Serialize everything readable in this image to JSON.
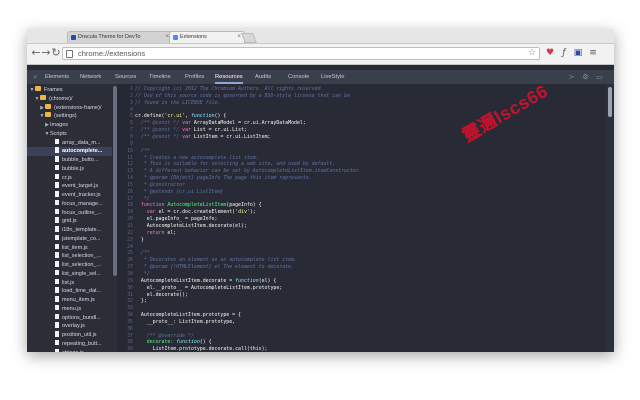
{
  "browser": {
    "tabs": [
      {
        "title": "Dracula Theme for DevTo",
        "close": "×",
        "favicon_color": "#1f4fb5",
        "active": false
      },
      {
        "title": "Extensions",
        "close": "×",
        "favicon_color": "#4c8bf5",
        "active": true
      }
    ],
    "nav": {
      "back": "←",
      "forward": "→",
      "reload": "↻"
    },
    "address": {
      "url": "chrome://extensions",
      "star": "☆"
    },
    "extension_icons": [
      "pocket-icon",
      "font-icon",
      "page-icon",
      "menu-icon"
    ],
    "extension_glyphs": [
      "♥",
      "ƒ",
      "▣",
      "≡"
    ]
  },
  "devtools": {
    "tabs": [
      "Elements",
      "Network",
      "Sources",
      "Timeline",
      "Profiles",
      "Resources",
      "Audits",
      "Console",
      "LiveStyle"
    ],
    "active_tab": "Resources",
    "search_glyph": "⌕",
    "right_glyphs": [
      "≻",
      "⚙",
      "▭"
    ]
  },
  "sidebar": {
    "rows": [
      {
        "label": "Frames",
        "depth": 0,
        "kind": "folder",
        "expanded": true,
        "selected": false
      },
      {
        "label": "(chrome)/",
        "depth": 1,
        "kind": "folder",
        "expanded": true,
        "selected": false
      },
      {
        "label": "(extensions-frame)/",
        "depth": 2,
        "kind": "folder",
        "expanded": false,
        "selected": false
      },
      {
        "label": "(settings)",
        "depth": 2,
        "kind": "folder",
        "expanded": true,
        "selected": false
      },
      {
        "label": "Images",
        "depth": 3,
        "kind": "group",
        "expanded": false,
        "selected": false
      },
      {
        "label": "Scripts",
        "depth": 3,
        "kind": "group",
        "expanded": true,
        "selected": false
      },
      {
        "label": "array_data_m...",
        "depth": 4,
        "kind": "file",
        "selected": false
      },
      {
        "label": "autocomplete...",
        "depth": 4,
        "kind": "file",
        "selected": true
      },
      {
        "label": "bubble_butto...",
        "depth": 4,
        "kind": "file",
        "selected": false
      },
      {
        "label": "bubble.js",
        "depth": 4,
        "kind": "file",
        "selected": false
      },
      {
        "label": "cr.js",
        "depth": 4,
        "kind": "file",
        "selected": false
      },
      {
        "label": "event_target.js",
        "depth": 4,
        "kind": "file",
        "selected": false
      },
      {
        "label": "event_tracker.js",
        "depth": 4,
        "kind": "file",
        "selected": false
      },
      {
        "label": "focus_manage...",
        "depth": 4,
        "kind": "file",
        "selected": false
      },
      {
        "label": "focus_outline_...",
        "depth": 4,
        "kind": "file",
        "selected": false
      },
      {
        "label": "grid.js",
        "depth": 4,
        "kind": "file",
        "selected": false
      },
      {
        "label": "i18n_template...",
        "depth": 4,
        "kind": "file",
        "selected": false
      },
      {
        "label": "jstemplate_co...",
        "depth": 4,
        "kind": "file",
        "selected": false
      },
      {
        "label": "list_item.js",
        "depth": 4,
        "kind": "file",
        "selected": false
      },
      {
        "label": "list_selection_...",
        "depth": 4,
        "kind": "file",
        "selected": false
      },
      {
        "label": "list_selection_...",
        "depth": 4,
        "kind": "file",
        "selected": false
      },
      {
        "label": "list_single_sel...",
        "depth": 4,
        "kind": "file",
        "selected": false
      },
      {
        "label": "list.js",
        "depth": 4,
        "kind": "file",
        "selected": false
      },
      {
        "label": "load_time_dat...",
        "depth": 4,
        "kind": "file",
        "selected": false
      },
      {
        "label": "menu_item.js",
        "depth": 4,
        "kind": "file",
        "selected": false
      },
      {
        "label": "menu.js",
        "depth": 4,
        "kind": "file",
        "selected": false
      },
      {
        "label": "options_bundl...",
        "depth": 4,
        "kind": "file",
        "selected": false
      },
      {
        "label": "overlay.js",
        "depth": 4,
        "kind": "file",
        "selected": false
      },
      {
        "label": "position_util.js",
        "depth": 4,
        "kind": "file",
        "selected": false
      },
      {
        "label": "repeating_butt...",
        "depth": 4,
        "kind": "file",
        "selected": false
      },
      {
        "label": "strings.js",
        "depth": 4,
        "kind": "file",
        "selected": false
      }
    ]
  },
  "editor": {
    "colors": {
      "comment": "#6272a4",
      "keyword": "#ff79c6",
      "plain": "#f8f8f2",
      "string": "#f1fa8c",
      "func": "#50fa7b",
      "type": "#8be9fd",
      "italic_type": "#8be9fd"
    },
    "lines": [
      {
        "n": "1",
        "tokens": [
          {
            "t": "// Copyright (c) 2012 The Chromium Authors. All rights reserved.",
            "c": "comment"
          }
        ]
      },
      {
        "n": "2",
        "tokens": [
          {
            "t": "// Use of this source code is governed by a BSD-style license that can be",
            "c": "comment"
          }
        ]
      },
      {
        "n": "3",
        "tokens": [
          {
            "t": "// found in the LICENSE file.",
            "c": "comment"
          }
        ]
      },
      {
        "n": "4",
        "tokens": []
      },
      {
        "n": "5",
        "tokens": [
          {
            "t": "cr.define(",
            "c": "plain"
          },
          {
            "t": "'cr.ui'",
            "c": "string"
          },
          {
            "t": ", ",
            "c": "plain"
          },
          {
            "t": "function",
            "c": "type"
          },
          {
            "t": "() {",
            "c": "plain"
          }
        ]
      },
      {
        "n": "6",
        "tokens": [
          {
            "t": "  /** @const */ ",
            "c": "comment"
          },
          {
            "t": "var ",
            "c": "keyword"
          },
          {
            "t": "ArrayDataModel = cr.ui.ArrayDataModel;",
            "c": "plain"
          }
        ]
      },
      {
        "n": "7",
        "tokens": [
          {
            "t": "  /** @const */ ",
            "c": "comment"
          },
          {
            "t": "var ",
            "c": "keyword"
          },
          {
            "t": "List = cr.ui.List;",
            "c": "plain"
          }
        ]
      },
      {
        "n": "8",
        "tokens": [
          {
            "t": "  /** @const */ ",
            "c": "comment"
          },
          {
            "t": "var ",
            "c": "keyword"
          },
          {
            "t": "ListItem = cr.ui.ListItem;",
            "c": "plain"
          }
        ]
      },
      {
        "n": "9",
        "tokens": []
      },
      {
        "n": "10",
        "tokens": [
          {
            "t": "  /**",
            "c": "comment"
          }
        ]
      },
      {
        "n": "11",
        "tokens": [
          {
            "t": "   * Creates a new autocomplete list item.",
            "c": "comment"
          }
        ]
      },
      {
        "n": "12",
        "tokens": [
          {
            "t": "   * This is suitable for selecting a web site, and used by default.",
            "c": "comment"
          }
        ]
      },
      {
        "n": "13",
        "tokens": [
          {
            "t": "   * A different behavior can be set by AutocompleteListItem.itemConstructor.",
            "c": "comment"
          }
        ]
      },
      {
        "n": "14",
        "tokens": [
          {
            "t": "   * @param {Object} pageInfo The page this item represents.",
            "c": "comment"
          }
        ]
      },
      {
        "n": "15",
        "tokens": [
          {
            "t": "   * @constructor",
            "c": "comment"
          }
        ]
      },
      {
        "n": "16",
        "tokens": [
          {
            "t": "   * @extends {cr.ui.ListItem}",
            "c": "comment"
          }
        ]
      },
      {
        "n": "17",
        "tokens": [
          {
            "t": "   */",
            "c": "comment"
          }
        ]
      },
      {
        "n": "18",
        "tokens": [
          {
            "t": "  function ",
            "c": "keyword"
          },
          {
            "t": "AutocompleteListItem",
            "c": "func"
          },
          {
            "t": "(pageInfo) {",
            "c": "plain"
          }
        ]
      },
      {
        "n": "19",
        "tokens": [
          {
            "t": "    var ",
            "c": "keyword"
          },
          {
            "t": "el = cr.doc.createElement(",
            "c": "plain"
          },
          {
            "t": "'div'",
            "c": "string"
          },
          {
            "t": ");",
            "c": "plain"
          }
        ]
      },
      {
        "n": "20",
        "tokens": [
          {
            "t": "    el.pageInfo_ = pageInfo;",
            "c": "plain"
          }
        ]
      },
      {
        "n": "21",
        "tokens": [
          {
            "t": "    AutocompleteListItem.decorate(el);",
            "c": "plain"
          }
        ]
      },
      {
        "n": "22",
        "tokens": [
          {
            "t": "    return ",
            "c": "keyword"
          },
          {
            "t": "el;",
            "c": "plain"
          }
        ]
      },
      {
        "n": "23",
        "tokens": [
          {
            "t": "  }",
            "c": "plain"
          }
        ]
      },
      {
        "n": "24",
        "tokens": []
      },
      {
        "n": "25",
        "tokens": [
          {
            "t": "  /**",
            "c": "comment"
          }
        ]
      },
      {
        "n": "26",
        "tokens": [
          {
            "t": "   * Decorates an element as an autocomplete list item.",
            "c": "comment"
          }
        ]
      },
      {
        "n": "27",
        "tokens": [
          {
            "t": "   * @param {!HTMLElement} el The element to decorate.",
            "c": "comment"
          }
        ]
      },
      {
        "n": "28",
        "tokens": [
          {
            "t": "   */",
            "c": "comment"
          }
        ]
      },
      {
        "n": "29",
        "tokens": [
          {
            "t": "  AutocompleteListItem.decorate = ",
            "c": "plain"
          },
          {
            "t": "function",
            "c": "type"
          },
          {
            "t": "(el) {",
            "c": "plain"
          }
        ]
      },
      {
        "n": "30",
        "tokens": [
          {
            "t": "    el.__proto__ = AutocompleteListItem.prototype;",
            "c": "plain"
          }
        ]
      },
      {
        "n": "31",
        "tokens": [
          {
            "t": "    el.decorate();",
            "c": "plain"
          }
        ]
      },
      {
        "n": "32",
        "tokens": [
          {
            "t": "  };",
            "c": "plain"
          }
        ]
      },
      {
        "n": "33",
        "tokens": []
      },
      {
        "n": "34",
        "tokens": [
          {
            "t": "  AutocompleteListItem.prototype = {",
            "c": "plain"
          }
        ]
      },
      {
        "n": "35",
        "tokens": [
          {
            "t": "    __proto__: ListItem.prototype,",
            "c": "plain"
          }
        ]
      },
      {
        "n": "36",
        "tokens": []
      },
      {
        "n": "37",
        "tokens": [
          {
            "t": "    /** @override */",
            "c": "comment"
          }
        ]
      },
      {
        "n": "38",
        "tokens": [
          {
            "t": "    decorate: ",
            "c": "func"
          },
          {
            "t": "function",
            "c": "type"
          },
          {
            "t": "() {",
            "c": "plain"
          }
        ]
      },
      {
        "n": "39",
        "tokens": [
          {
            "t": "      ListItem.prototype.decorate.call(this);",
            "c": "plain"
          }
        ]
      }
    ]
  },
  "watermark": {
    "text": "靈邇lscs66",
    "color": "#d3112d"
  }
}
